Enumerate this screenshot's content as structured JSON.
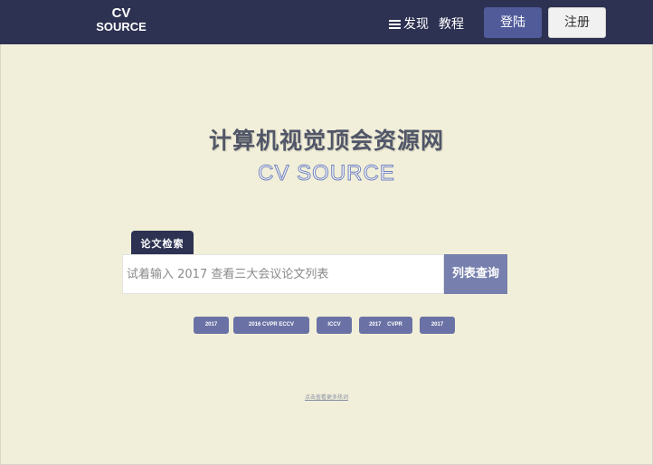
{
  "header": {
    "logo_line1": "CV",
    "logo_line2": "SOURCE",
    "nav": {
      "discover_label": "发现",
      "discover_icon": "menu-icon",
      "tutorial_label": "教程"
    },
    "login_label": "登陆",
    "register_label": "注册",
    "colors": {
      "header_bg": "#2d3252",
      "login_bg": "#515b9a"
    }
  },
  "hero": {
    "title": "计算机视觉顶会资源网",
    "subtitle": "CV SOURCE"
  },
  "search": {
    "tab_label": "论文检索",
    "placeholder": "试着输入 2017 查看三大会议论文列表",
    "value": "",
    "button_label": "列表查询",
    "colors": {
      "button_bg": "#767fad"
    }
  },
  "tags": [
    "2017",
    "2016 CVPR ECCV",
    "ICCV",
    "2017    CVPR",
    "2017"
  ],
  "footer": {
    "link_label": "点击查看更多热词"
  },
  "colors": {
    "page_bg": "#f1efd9",
    "tag_bg": "#6a72a5"
  }
}
